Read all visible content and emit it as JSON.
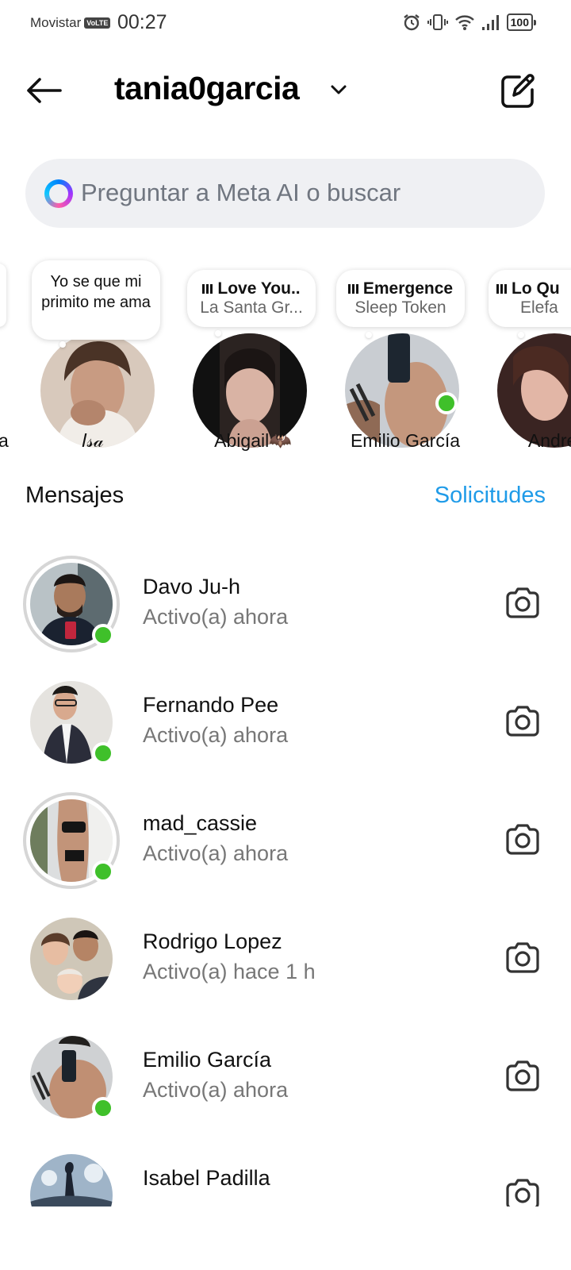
{
  "status_bar": {
    "carrier": "Movistar",
    "network_badge": "VoLTE",
    "time": "00:27",
    "battery": "100"
  },
  "header": {
    "account_name": "tania0garcia",
    "back_icon": "arrow-left-icon",
    "compose_icon": "compose-icon"
  },
  "search": {
    "placeholder": "Preguntar a Meta AI o buscar"
  },
  "notes": [
    {
      "name": "𝐼𝓈𝒶",
      "note_text": "Yo se que mi primito me ama",
      "online": false
    },
    {
      "name": "Abigail🦇",
      "music_title": "Love You..",
      "music_artist": "La Santa Gr...",
      "online": false
    },
    {
      "name": "Emilio García",
      "music_title": "Emergence",
      "music_artist": "Sleep Token",
      "online": true
    },
    {
      "name": "Andrea",
      "music_title": "Lo Qu",
      "music_artist": "Elefa",
      "online": false
    }
  ],
  "partial_left_note_name": "a",
  "messages_section": {
    "title": "Mensajes",
    "requests_label": "Solicitudes",
    "requests_color": "#1f9be8"
  },
  "messages": [
    {
      "name": "Davo Ju-h",
      "status": "Activo(a) ahora",
      "online": true,
      "story_ring": true
    },
    {
      "name": "Fernando Pee",
      "status": "Activo(a) ahora",
      "online": true,
      "story_ring": false
    },
    {
      "name": "mad_cassie",
      "status": "Activo(a) ahora",
      "online": true,
      "story_ring": true
    },
    {
      "name": "Rodrigo Lopez",
      "status": "Activo(a) hace 1 h",
      "online": false,
      "story_ring": false
    },
    {
      "name": "Emilio García",
      "status": "Activo(a) ahora",
      "online": true,
      "story_ring": false
    },
    {
      "name": "Isabel Padilla",
      "status": "",
      "online": false,
      "story_ring": false
    }
  ],
  "colors": {
    "online": "#3fc02a",
    "accent": "#1f9be8"
  }
}
